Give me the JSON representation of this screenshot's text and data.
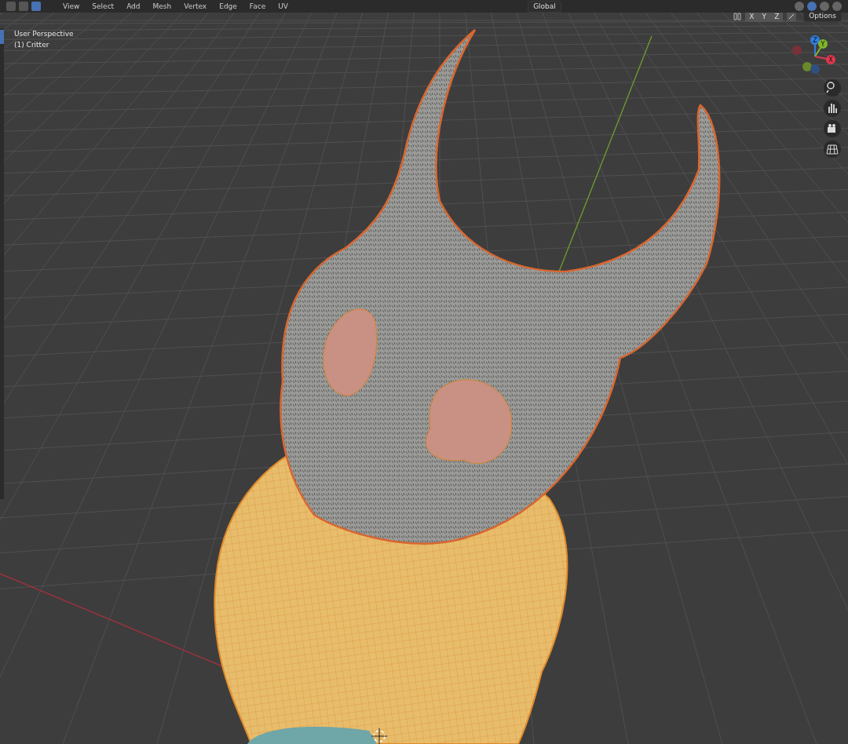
{
  "header": {
    "select_modes": [
      {
        "selected": false
      },
      {
        "selected": false
      },
      {
        "selected": true
      }
    ],
    "menus": [
      {
        "label": "View"
      },
      {
        "label": "Select"
      },
      {
        "label": "Add"
      },
      {
        "label": "Mesh"
      },
      {
        "label": "Vertex"
      },
      {
        "label": "Edge"
      },
      {
        "label": "Face"
      },
      {
        "label": "UV"
      }
    ],
    "transform_orientation": "Global",
    "shading_modes": [
      {
        "selected": false
      },
      {
        "selected": true
      },
      {
        "selected": false
      },
      {
        "selected": false
      }
    ]
  },
  "tool_header": {
    "axes": [
      {
        "label": "X"
      },
      {
        "label": "Y"
      },
      {
        "label": "Z"
      }
    ],
    "options": "Options"
  },
  "viewport": {
    "perspective": "User Perspective",
    "object": "(1) Critter"
  },
  "gizmo": {
    "axes": [
      {
        "label": "Z",
        "color": "#2f7fe0"
      },
      {
        "label": "Y",
        "color": "#7fb52a"
      },
      {
        "label": "X",
        "color": "#e0384f"
      }
    ]
  }
}
